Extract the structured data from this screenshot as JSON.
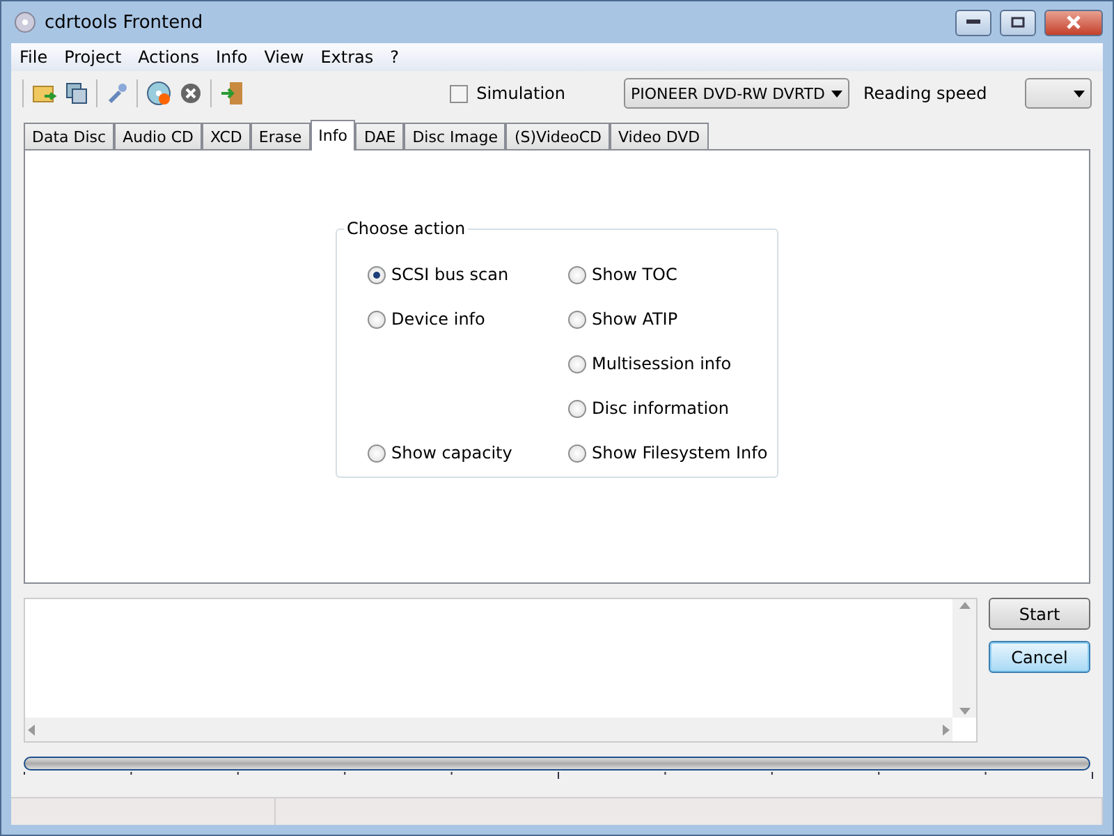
{
  "window": {
    "title": "cdrtools Frontend"
  },
  "menu": [
    "File",
    "Project",
    "Actions",
    "Info",
    "View",
    "Extras",
    "?"
  ],
  "toolbar": {
    "simulation": {
      "label": "Simulation",
      "checked": false
    },
    "device": "PIONEER DVD-RW DVRTD",
    "reading_speed_label": "Reading speed"
  },
  "tabs": [
    {
      "label": "Data Disc",
      "selected": false
    },
    {
      "label": "Audio CD",
      "selected": false
    },
    {
      "label": "XCD",
      "selected": false
    },
    {
      "label": "Erase",
      "selected": false
    },
    {
      "label": "Info",
      "selected": true
    },
    {
      "label": "DAE",
      "selected": false
    },
    {
      "label": "Disc Image",
      "selected": false
    },
    {
      "label": "(S)VideoCD",
      "selected": false
    },
    {
      "label": "Video DVD",
      "selected": false
    }
  ],
  "choose_action": {
    "title": "Choose action",
    "rows": [
      {
        "left": {
          "label": "SCSI bus scan",
          "selected": true
        },
        "right": {
          "label": "Show TOC",
          "selected": false
        }
      },
      {
        "left": {
          "label": "Device info",
          "selected": false
        },
        "right": {
          "label": "Show ATIP",
          "selected": false
        }
      },
      {
        "right": {
          "label": "Multisession info",
          "selected": false
        }
      },
      {
        "right": {
          "label": "Disc information",
          "selected": false
        }
      },
      {
        "left": {
          "label": "Show capacity",
          "selected": false
        },
        "right": {
          "label": "Show Filesystem Info",
          "selected": false
        }
      }
    ]
  },
  "buttons": [
    {
      "label": "Start",
      "focused": false
    },
    {
      "label": "Cancel",
      "focused": true
    }
  ]
}
